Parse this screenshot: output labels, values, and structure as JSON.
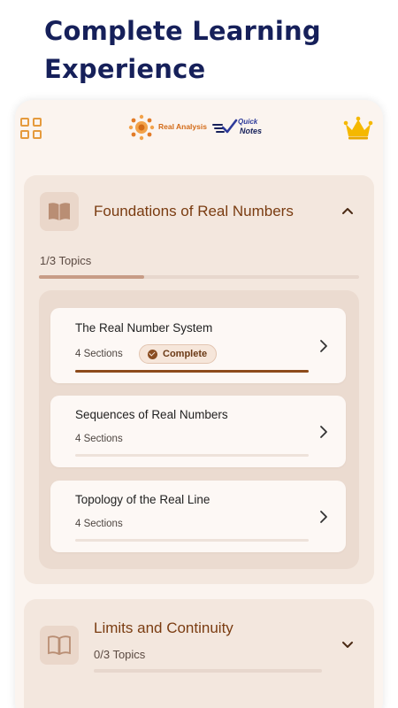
{
  "headline": {
    "line1": "Complete Learning",
    "line2": "Experience"
  },
  "app_header": {
    "logo_real_analysis": "Real Analysis",
    "logo_quick": "Quick",
    "logo_notes": "Notes",
    "menu_icon": "grid-menu-icon",
    "premium_icon": "crown-icon"
  },
  "modules": [
    {
      "title": "Foundations of Real Numbers",
      "topics_count": "1/3 Topics",
      "progress": 0.33,
      "expanded": true,
      "icon": "open-book-icon",
      "topics": [
        {
          "title": "The Real Number System",
          "sections": "4 Sections",
          "status": "Complete",
          "progress": 1.0
        },
        {
          "title": "Sequences of Real Numbers",
          "sections": "4 Sections",
          "status": "",
          "progress": 0.0
        },
        {
          "title": "Topology of the Real Line",
          "sections": "4 Sections",
          "status": "",
          "progress": 0.0
        }
      ]
    },
    {
      "title": "Limits and Continuity",
      "topics_count": "0/3 Topics",
      "progress": 0.0,
      "expanded": false,
      "icon": "open-book-icon"
    }
  ],
  "colors": {
    "headline": "#16205a",
    "accent_brown": "#7a3c11",
    "progress_dark": "#8d4b1b",
    "crown": "#f5b800",
    "menu_icon": "#e59a3d"
  }
}
